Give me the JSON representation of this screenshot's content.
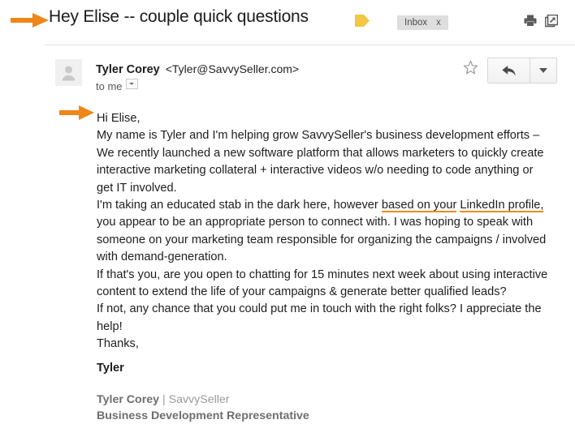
{
  "header": {
    "subject": "Hey Elise -- couple quick questions",
    "label_tag_color": "#f2c744",
    "label_tag_icon": "label-tag-icon",
    "inbox_chip_label": "Inbox",
    "inbox_chip_remove": "x",
    "print_icon": "print-icon",
    "popout_icon": "open-in-new-window-icon"
  },
  "message": {
    "avatar_icon": "person-avatar-icon",
    "sender_name": "Tyler Corey",
    "sender_email": "<Tyler@SavvySeller.com>",
    "recipient": "to me",
    "recipient_caret_icon": "chevron-down-icon",
    "star_icon": "star-outline-icon",
    "reply_icon": "reply-arrow-icon",
    "reply_menu_icon": "chevron-down-icon",
    "body": {
      "greeting": "Hi Elise,",
      "paragraph_1_pre": "My name is Tyler and I'm helping grow SavvySeller's business development efforts – We recently launched a new software platform that allows marketers to quickly create interactive marketing collateral + interactive videos w/o needing to code anything or get IT involved.",
      "paragraph_2_pre": "I'm taking an educated stab in the dark here, however ",
      "paragraph_2_highlight_a": "based on your",
      "paragraph_2_highlight_b": "LinkedIn profile,",
      "paragraph_2_post": " you appear to be an appropriate person to connect with. I was hoping to speak with someone on your marketing team responsible for organizing the campaigns / involved with demand-generation.",
      "paragraph_3": "If that's you, are you open to chatting for 15 minutes next week about using interactive content to extend the life of your campaigns & generate better qualified leads?",
      "paragraph_4": "If not, any chance that you could put me in touch with the right folks? I appreciate the help!",
      "paragraph_5": "Thanks,",
      "signoff_name": "Tyler"
    },
    "signature": {
      "name": "Tyler Corey",
      "separator": "|",
      "company": "SavvySeller",
      "title": "Business Development Representative"
    }
  },
  "annotations": {
    "arrow_color": "#ef8718",
    "underline_color": "#ef8a1c",
    "arrow_subject_icon": "orange-arrow-icon",
    "arrow_greeting_icon": "orange-arrow-icon"
  }
}
